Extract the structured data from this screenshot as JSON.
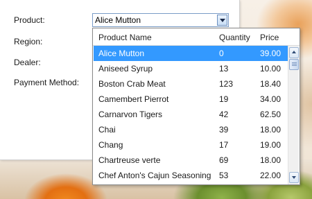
{
  "form": {
    "product_label": "Product:",
    "region_label": "Region:",
    "dealer_label": "Dealer:",
    "payment_label": "Payment Method:"
  },
  "combo": {
    "value": "Alice Mutton",
    "border_color": "#7a9cc7"
  },
  "dropdown": {
    "columns": [
      "Product Name",
      "Quantity",
      "Price"
    ],
    "rows": [
      {
        "name": "Alice Mutton",
        "qty": "0",
        "price": "39.00",
        "selected": true
      },
      {
        "name": "Aniseed Syrup",
        "qty": "13",
        "price": "10.00"
      },
      {
        "name": "Boston Crab Meat",
        "qty": "123",
        "price": "18.40"
      },
      {
        "name": "Camembert Pierrot",
        "qty": "19",
        "price": "34.00"
      },
      {
        "name": "Carnarvon Tigers",
        "qty": "42",
        "price": "62.50"
      },
      {
        "name": "Chai",
        "qty": "39",
        "price": "18.00"
      },
      {
        "name": "Chang",
        "qty": "17",
        "price": "19.00"
      },
      {
        "name": "Chartreuse verte",
        "qty": "69",
        "price": "18.00"
      },
      {
        "name": "Chef Anton's Cajun Seasoning",
        "qty": "53",
        "price": "22.00"
      }
    ],
    "selected_color": "#3399ff"
  },
  "icons": {
    "combo_button": "chevron-down-icon",
    "scroll_up": "arrow-up-icon",
    "scroll_down": "arrow-down-icon"
  }
}
